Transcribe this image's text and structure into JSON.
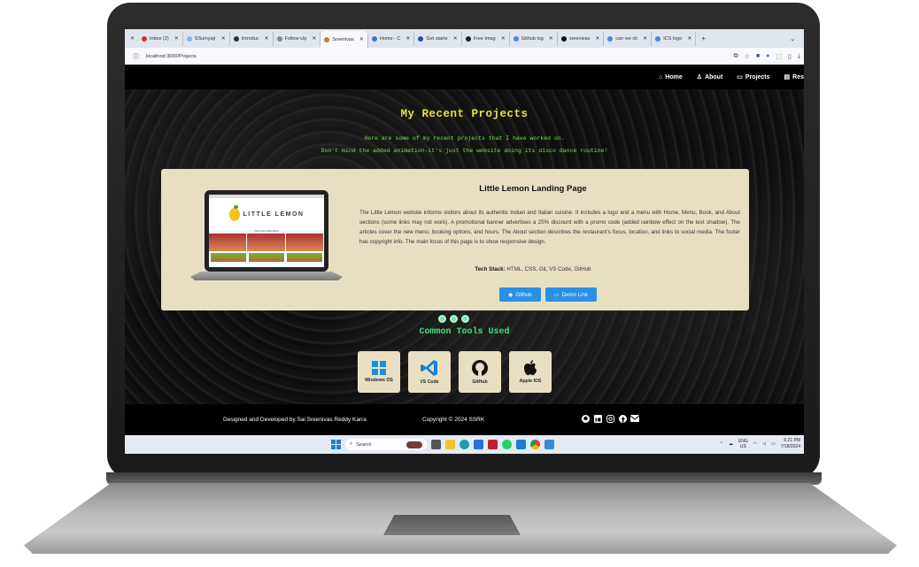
{
  "browser": {
    "tabs": [
      {
        "label": "Inbox (2)",
        "color": "#d93025"
      },
      {
        "label": "SSumyajr",
        "color": "#8ab4f8"
      },
      {
        "label": "Introduc",
        "color": "#333333"
      },
      {
        "label": "Follow-Up",
        "color": "#888888"
      },
      {
        "label": "Sreenivas",
        "color": "#c97c2a",
        "active": true
      },
      {
        "label": "Home - C",
        "color": "#3a7bd5"
      },
      {
        "label": "Get starte",
        "color": "#2a4db5"
      },
      {
        "label": "Free Imag",
        "color": "#222222"
      },
      {
        "label": "Github log",
        "color": "#4285f4"
      },
      {
        "label": "sreenivas",
        "color": "#111111"
      },
      {
        "label": "can we ch",
        "color": "#4285f4"
      },
      {
        "label": "ICS logo",
        "color": "#4285f4"
      }
    ],
    "new_tab": "+",
    "url": "localhost:3000/Projects"
  },
  "nav": {
    "items": [
      "Home",
      "About",
      "Projects",
      "Res"
    ]
  },
  "projects": {
    "title": "My Recent Projects",
    "subtitle1": "Here are some of my recent projects that I have worked on.",
    "subtitle2": "Don't mind the added animation-it's just the website doing its disco dance routine!",
    "card": {
      "mockup_brand": "LITTLE LEMON",
      "mockup_menu": "Home  Menu  Book  About",
      "title": "Little Lemon Landing Page",
      "description": "The Little Lemon website informs visitors about its authentic Indian and Italian cuisine. It includes a logo and a menu with Home, Menu, Book, and About sections (some links may not work). A promotional banner advertises a 25% discount with a promo code (added rainbow effect on the text shadow). The articles cover the new menu, booking options, and hours. The About section describes the restaurant's focus, location, and links to social media. The footer has copyright info. The main focus of this page is to show responsive design.",
      "tech_label": "Tech Stack:",
      "tech_value": " HTML, CSS, Git, VS Code, GitHub",
      "github_btn": "Github",
      "demo_btn": "Demo Link"
    }
  },
  "tools": {
    "title": "Common Tools Used",
    "items": [
      {
        "label": "Windows OS",
        "icon": "windows-icon"
      },
      {
        "label": "VS Code",
        "icon": "vscode-icon"
      },
      {
        "label": "GitHub",
        "icon": "github-icon"
      },
      {
        "label": "Apple IOS",
        "icon": "apple-icon"
      }
    ]
  },
  "footer": {
    "developer": "Designed and Developed by Sai Sreenivas Reddy Karra",
    "copyright": "Copyright © 2024 SSRK",
    "social_icons": [
      "github-icon",
      "linkedin-icon",
      "instagram-icon",
      "facebook-icon",
      "mail-icon"
    ]
  },
  "taskbar": {
    "search_placeholder": "Search",
    "lang_top": "ENG",
    "lang_bottom": "US",
    "time": "6:21 PM",
    "date": "7/18/2024"
  },
  "colors": {
    "heading": "#e8e23a",
    "subtitle": "#6ee64a",
    "card": "#e8dfc2",
    "button": "#2a8fe6",
    "tools_heading": "#3ee07a"
  }
}
